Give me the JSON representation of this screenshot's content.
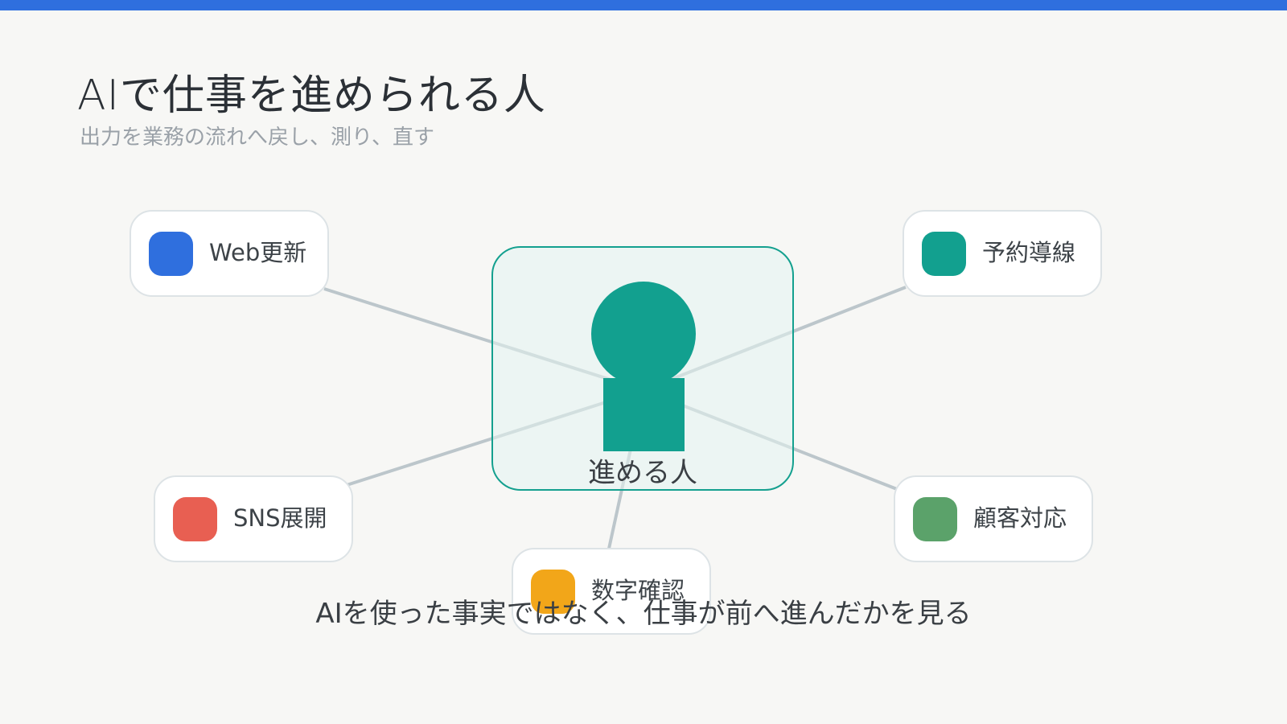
{
  "title": "AIで仕事を進められる人",
  "subtitle": "出力を業務の流れへ戻し、測り、直す",
  "center": {
    "label": "進める人",
    "color": "#12a08f"
  },
  "nodes": [
    {
      "label": "Web更新",
      "color": "#2f6fde"
    },
    {
      "label": "予約導線",
      "color": "#12a08f"
    },
    {
      "label": "SNS展開",
      "color": "#e85f52"
    },
    {
      "label": "顧客対応",
      "color": "#5ba26a"
    },
    {
      "label": "数字確認",
      "color": "#f2a619"
    }
  ],
  "caption": "AIを使った事実ではなく、仕事が前へ進んだかを見る",
  "colors": {
    "accent_bar": "#2f6fde",
    "edge": "#bcc6cb",
    "background": "#f7f7f5"
  }
}
